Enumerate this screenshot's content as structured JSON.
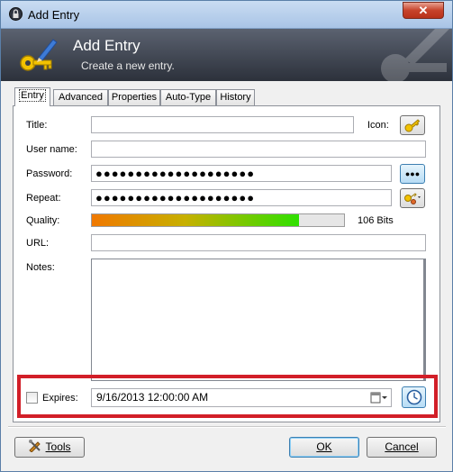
{
  "window": {
    "title": "Add Entry",
    "close_glyph": "✕"
  },
  "banner": {
    "title": "Add Entry",
    "subtitle": "Create a new entry."
  },
  "tabs": [
    {
      "label": "Entry",
      "active": true
    },
    {
      "label": "Advanced",
      "active": false
    },
    {
      "label": "Properties",
      "active": false
    },
    {
      "label": "Auto-Type",
      "active": false
    },
    {
      "label": "History",
      "active": false
    }
  ],
  "form": {
    "title_label": "Title:",
    "title_value": "",
    "icon_label": "Icon:",
    "username_label": "User name:",
    "username_value": "",
    "password_label": "Password:",
    "password_value": "●●●●●●●●●●●●●●●●●●●●",
    "password_toggle_label": "●●●",
    "repeat_label": "Repeat:",
    "repeat_value": "●●●●●●●●●●●●●●●●●●●●",
    "quality_label": "Quality:",
    "quality_fraction": 0.82,
    "quality_text": "106 Bits",
    "url_label": "URL:",
    "url_value": "",
    "notes_label": "Notes:",
    "notes_value": "",
    "expires_label": "Expires:",
    "expires_checked": false,
    "expires_value": "9/16/2013 12:00:00 AM"
  },
  "buttons": {
    "tools_label": "Tools",
    "ok_label": "OK",
    "cancel_label": "Cancel"
  },
  "colors": {
    "highlight_border": "#d21f28",
    "quality_low": "#f07800",
    "quality_high": "#2ee000"
  }
}
